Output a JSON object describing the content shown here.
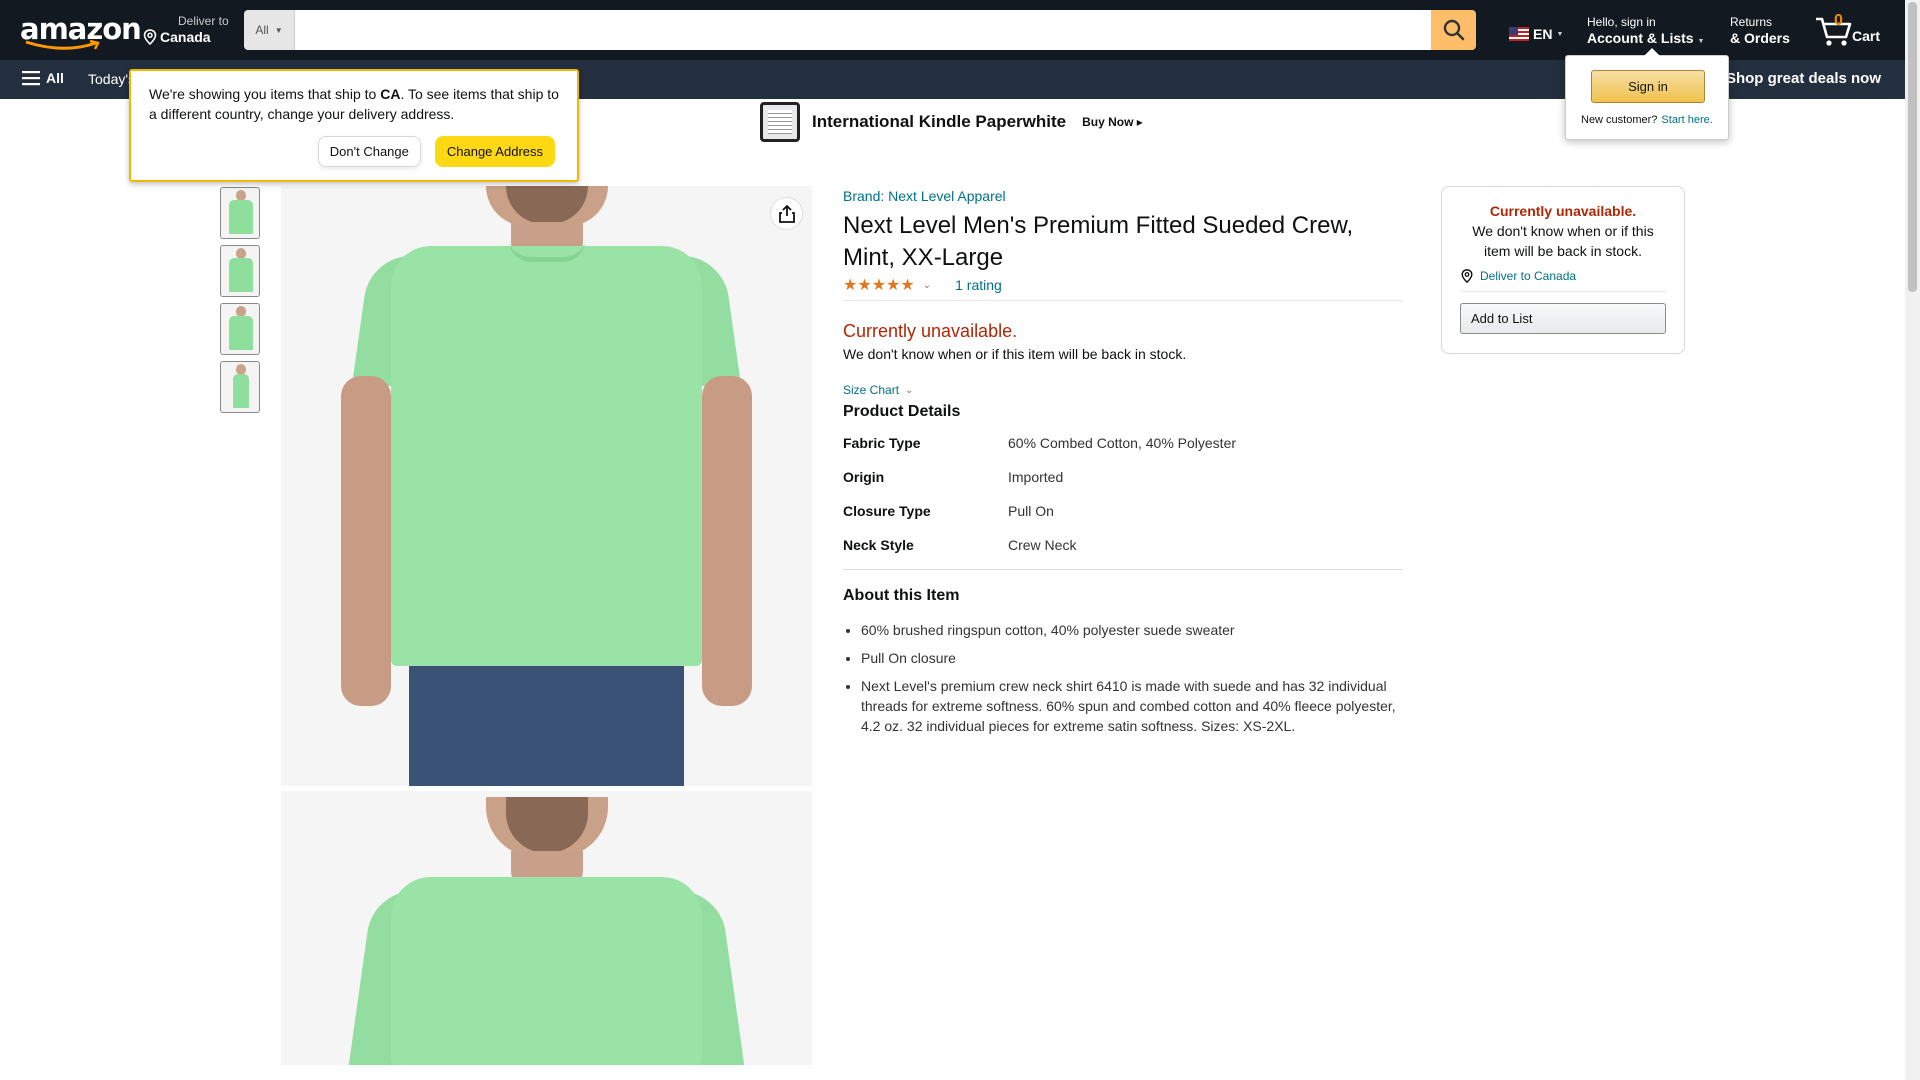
{
  "header": {
    "logo_text": "amazon",
    "deliver_line1": "Deliver to",
    "deliver_line2": "Canada",
    "search_category": "All",
    "search_value": "",
    "language": "EN",
    "account_line1": "Hello, sign in",
    "account_line2": "Account & Lists",
    "returns_line1": "Returns",
    "returns_line2": "& Orders",
    "cart_count": "0",
    "cart_label": "Cart"
  },
  "subnav": {
    "all_label": "All",
    "todays_label": "Today's",
    "shop_deals": "Shop great deals now"
  },
  "banner": {
    "title": "International Kindle Paperwhite",
    "cta": "Buy Now ▸"
  },
  "delivery_popover": {
    "text_before": "We're showing you items that ship to ",
    "country": "CA",
    "text_after": ". To see items that ship to a different country, change your delivery address.",
    "dont_change": "Don't Change",
    "change_address": "Change Address"
  },
  "signin_flyout": {
    "button": "Sign in",
    "new_customer": "New customer?",
    "start_here": "Start here."
  },
  "product": {
    "brand": "Brand: Next Level Apparel",
    "title": "Next Level Men's Premium Fitted Sueded Crew, Mint, XX-Large",
    "stars": "★★★★★",
    "rating_count": "1 rating",
    "unavailable": "Currently unavailable.",
    "unavailable_sub": "We don't know when or if this item will be back in stock.",
    "size_chart": "Size Chart",
    "details_title": "Product Details",
    "details": [
      {
        "key": "Fabric Type",
        "value": "60% Combed Cotton, 40% Polyester"
      },
      {
        "key": "Origin",
        "value": "Imported"
      },
      {
        "key": "Closure Type",
        "value": "Pull On"
      },
      {
        "key": "Neck Style",
        "value": "Crew Neck"
      }
    ],
    "about_title": "About this Item",
    "about": [
      "60% brushed ringspun cotton, 40% polyester suede sweater",
      "Pull On closure",
      "Next Level's premium crew neck shirt 6410 is made with suede and has 32 individual threads for extreme softness. 60% spun and combed cotton and 40% fleece polyester, 4.2 oz. 32 individual pieces for extreme satin softness. Sizes: XS-2XL."
    ]
  },
  "buybox": {
    "unavailable": "Currently unavailable.",
    "sub": "We don't know when or if this item will be back in stock.",
    "deliver": "Deliver to Canada",
    "add_to_list": "Add to List"
  },
  "colors": {
    "nav_dark": "#131921",
    "nav_secondary": "#232f3e",
    "search_button": "#febd69",
    "link": "#007185",
    "unavailable": "#b12704",
    "shirt_mint": "#98e3a5"
  }
}
